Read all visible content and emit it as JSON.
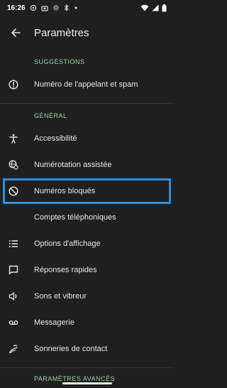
{
  "status": {
    "time": "16:26"
  },
  "appbar": {
    "title": "Paramètres"
  },
  "sections": {
    "suggestions": {
      "header": "SUGGESTIONS",
      "items": [
        {
          "label": "Numéro de l'appelant et spam"
        }
      ]
    },
    "general": {
      "header": "GÉNÉRAL",
      "items": [
        {
          "label": "Accessibilité"
        },
        {
          "label": "Numérotation assistée"
        },
        {
          "label": "Numéros bloqués"
        },
        {
          "label": "Comptes téléphoniques"
        },
        {
          "label": "Options d'affichage"
        },
        {
          "label": "Réponses rapides"
        },
        {
          "label": "Sons et vibreur"
        },
        {
          "label": "Messagerie"
        },
        {
          "label": "Sonneries de contact"
        }
      ]
    },
    "advanced": {
      "header": "PARAMÈTRES AVANCÉS"
    }
  },
  "colors": {
    "background": "#1f1f1f",
    "accent_header": "#9fd3a6",
    "highlight_border": "#2b8fde"
  }
}
